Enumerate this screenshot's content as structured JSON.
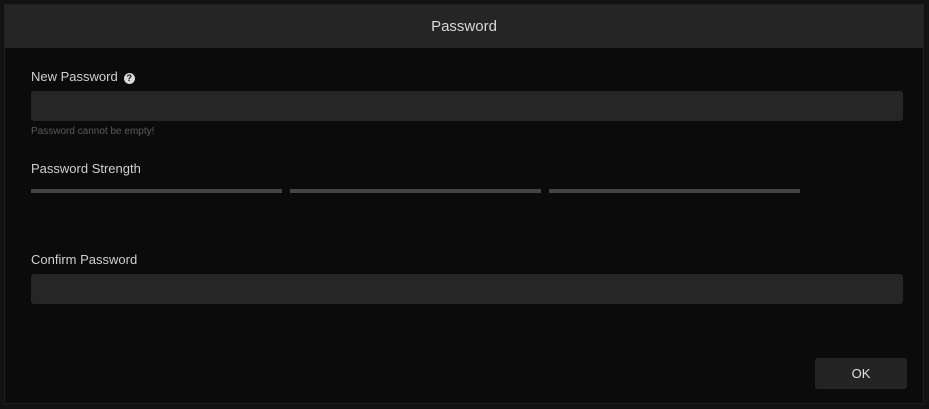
{
  "dialog": {
    "title": "Password"
  },
  "new_password": {
    "label": "New Password",
    "help_icon": "question-circle-icon",
    "help_glyph": "?",
    "value": "",
    "placeholder": "",
    "error": "Password cannot be empty!"
  },
  "strength": {
    "label": "Password Strength",
    "segments": 3,
    "filled_segments": 0
  },
  "confirm_password": {
    "label": "Confirm Password",
    "value": "",
    "placeholder": ""
  },
  "buttons": {
    "ok_label": "OK"
  },
  "colors": {
    "background": "#0b0b0b",
    "titlebar": "#252525",
    "input": "#262626",
    "strength_bar_empty": "#454545",
    "error_text": "#5b5b5b"
  }
}
